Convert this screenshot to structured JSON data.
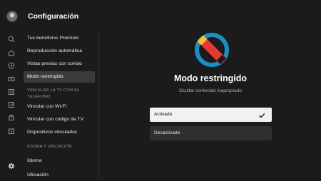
{
  "app": {
    "title": "Configuración"
  },
  "rail_icons": [
    "search-icon",
    "home-icon",
    "explore-icon",
    "subscriptions-icon",
    "library-icon",
    "history-icon",
    "movies-icon",
    "queue-icon",
    "settings-icon"
  ],
  "sidebar": {
    "items": [
      {
        "label": "Tus beneficios Premium"
      },
      {
        "label": "Reproducción automática"
      },
      {
        "label": "Vistas previas con sonido"
      },
      {
        "label": "Modo restringido",
        "selected": true
      },
      {
        "label": "Vincular con Wi-Fi"
      },
      {
        "label": "Vincular con código de TV"
      },
      {
        "label": "Dispositivos vinculados"
      },
      {
        "label": "Idioma"
      },
      {
        "label": "Ubicación"
      }
    ],
    "sections": {
      "tv_link": "VINCULAR LA TV CON EL TELÉFONO",
      "language": "IDIOMA Y UBICACIÓN"
    }
  },
  "main": {
    "title": "Modo restringido",
    "subtitle": "Ocultar contenido inapropiado",
    "options": [
      {
        "label": "Activado",
        "checked": true
      },
      {
        "label": "Desactivado",
        "checked": false
      }
    ]
  },
  "colors": {
    "background": "#1b1b1b",
    "selected_item": "#3b3b3b",
    "logo_ring": "#1a8fc4",
    "logo_red": "#e53935",
    "logo_yellow": "#f4c430"
  }
}
